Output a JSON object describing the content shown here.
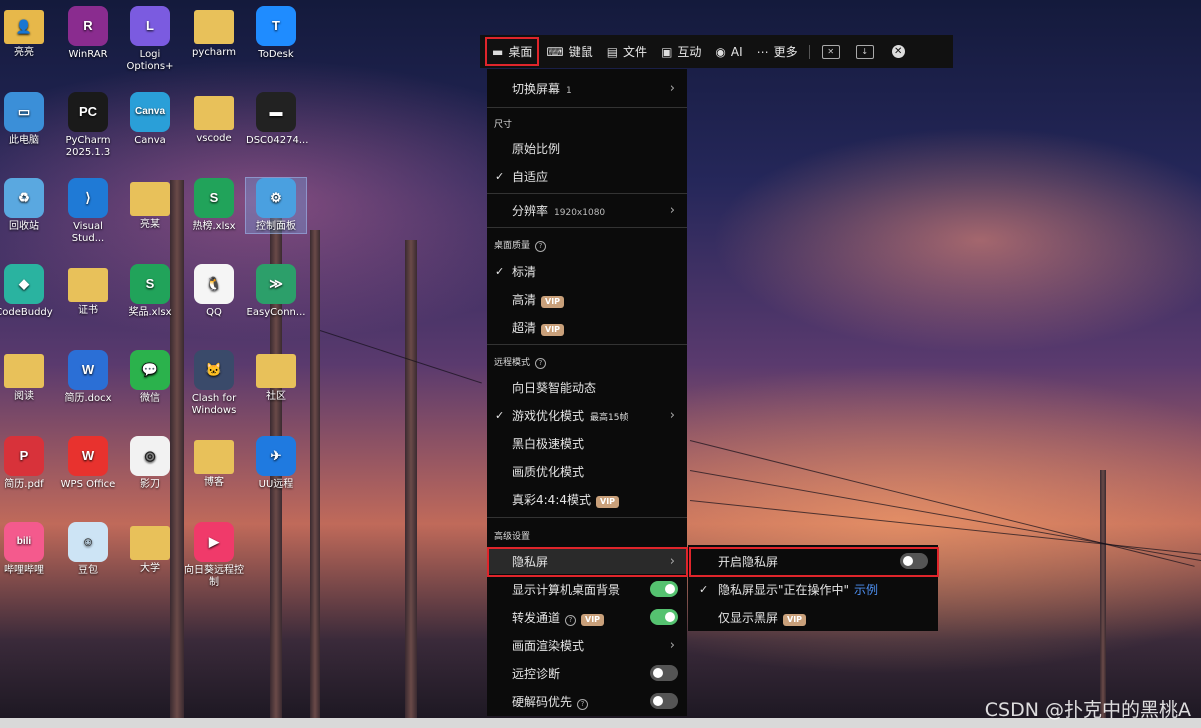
{
  "desktop_icons": [
    {
      "label": "亮亮",
      "icon": "folder-user-icon",
      "color": "#e7b84a",
      "glyph": "👤"
    },
    {
      "label": "WinRAR",
      "icon": "winrar-icon",
      "color": "#8a2c8f",
      "glyph": "R"
    },
    {
      "label": "Logi Options+",
      "icon": "logi-icon",
      "color": "#7b5be0",
      "glyph": "L"
    },
    {
      "label": "pycharm",
      "icon": "folder-icon",
      "color": "#e8c15a",
      "glyph": ""
    },
    {
      "label": "ToDesk",
      "icon": "todesk-icon",
      "color": "#1f8cff",
      "glyph": "T"
    },
    {
      "label": "此电脑",
      "icon": "computer-icon",
      "color": "#3b8fd8",
      "glyph": "▭"
    },
    {
      "label": "PyCharm 2025.1.3",
      "icon": "pycharm-icon",
      "color": "#1a1a1a",
      "glyph": "PC"
    },
    {
      "label": "Canva",
      "icon": "canva-icon",
      "color": "#2a9fd8",
      "glyph": "Canva"
    },
    {
      "label": "vscode",
      "icon": "folder-icon",
      "color": "#e8c15a",
      "glyph": ""
    },
    {
      "label": "DSC04274...",
      "icon": "image-file-icon",
      "color": "#222",
      "glyph": "▬"
    },
    {
      "label": "回收站",
      "icon": "recycle-bin-icon",
      "color": "#5aa8e0",
      "glyph": "♻"
    },
    {
      "label": "Visual Stud...",
      "icon": "vscode-icon",
      "color": "#1f7ad6",
      "glyph": "⟩"
    },
    {
      "label": "亮某",
      "icon": "folder-icon",
      "color": "#e8c15a",
      "glyph": ""
    },
    {
      "label": "热榜.xlsx",
      "icon": "spreadsheet-icon",
      "color": "#21a35a",
      "glyph": "S"
    },
    {
      "label": "控制面板",
      "icon": "control-panel-icon",
      "color": "#4aa0e0",
      "glyph": "⚙"
    },
    {
      "label": "CodeBuddy",
      "icon": "codebuddy-icon",
      "color": "#2ab3a0",
      "glyph": "◆"
    },
    {
      "label": "证书",
      "icon": "folder-icon",
      "color": "#e8c15a",
      "glyph": ""
    },
    {
      "label": "奖品.xlsx",
      "icon": "spreadsheet-icon",
      "color": "#21a35a",
      "glyph": "S"
    },
    {
      "label": "QQ",
      "icon": "qq-icon",
      "color": "#f5f5f5",
      "glyph": "🐧"
    },
    {
      "label": "EasyConn...",
      "icon": "easyconnect-icon",
      "color": "#2c9f6a",
      "glyph": "≫"
    },
    {
      "label": "阅读",
      "icon": "folder-icon",
      "color": "#e8c15a",
      "glyph": ""
    },
    {
      "label": "简历.docx",
      "icon": "word-doc-icon",
      "color": "#2b6fd6",
      "glyph": "W"
    },
    {
      "label": "微信",
      "icon": "wechat-icon",
      "color": "#2bb24c",
      "glyph": "💬"
    },
    {
      "label": "Clash for Windows",
      "icon": "clash-icon",
      "color": "#3a4a6a",
      "glyph": "🐱"
    },
    {
      "label": "社区",
      "icon": "folder-icon",
      "color": "#e8c15a",
      "glyph": ""
    },
    {
      "label": "简历.pdf",
      "icon": "pdf-icon",
      "color": "#d8323a",
      "glyph": "P"
    },
    {
      "label": "WPS Office",
      "icon": "wps-icon",
      "color": "#e8322e",
      "glyph": "W"
    },
    {
      "label": "影刀",
      "icon": "yingdao-icon",
      "color": "#f2f2f2",
      "glyph": "◎"
    },
    {
      "label": "博客",
      "icon": "folder-icon",
      "color": "#e8c15a",
      "glyph": ""
    },
    {
      "label": "UU远程",
      "icon": "uu-remote-icon",
      "color": "#1f7ae0",
      "glyph": "✈"
    },
    {
      "label": "哔哩哔哩",
      "icon": "bilibili-icon",
      "color": "#f45a8d",
      "glyph": "bili"
    },
    {
      "label": "豆包",
      "icon": "doubao-icon",
      "color": "#cde4f5",
      "glyph": "☺"
    },
    {
      "label": "大学",
      "icon": "folder-icon",
      "color": "#e8c15a",
      "glyph": ""
    },
    {
      "label": "向日葵远程控制",
      "icon": "sunlogin-icon",
      "color": "#f03a6a",
      "glyph": "▶"
    }
  ],
  "toolbar": {
    "desktop": "桌面",
    "keyboard_mouse": "键鼠",
    "file": "文件",
    "interact": "互动",
    "ai": "AI",
    "more": "更多"
  },
  "menu": {
    "switch_screen": "切换屏幕",
    "switch_screen_count": "1",
    "size_section": "尺寸",
    "original_ratio": "原始比例",
    "adaptive": "自适应",
    "resolution": "分辨率",
    "resolution_value": "1920x1080",
    "quality_section": "桌面质量",
    "standard": "标清",
    "high": "高清",
    "ultra": "超清",
    "remote_mode_section": "远程模式",
    "smart_dynamic": "向日葵智能动态",
    "game_mode": "游戏优化模式",
    "game_mode_note": "最高15帧",
    "bw_mode": "黑白极速模式",
    "quality_mode": "画质优化模式",
    "true_color": "真彩4:4:4模式",
    "advanced_section": "高级设置",
    "privacy_screen": "隐私屏",
    "show_bg": "显示计算机桌面背景",
    "relay": "转发通道",
    "render_mode": "画面渲染模式",
    "remote_diag": "远控诊断",
    "hw_decode": "硬解码优先",
    "vip": "VIP"
  },
  "submenu": {
    "enable_privacy": "开启隐私屏",
    "show_operating": "隐私屏显示\"正在操作中\"",
    "example": "示例",
    "black_only": "仅显示黑屏"
  },
  "toggles": {
    "show_bg": true,
    "relay": true,
    "remote_diag": false,
    "hw_decode": false,
    "enable_privacy": false
  },
  "watermark": "CSDN @扑克中的黑桃A"
}
